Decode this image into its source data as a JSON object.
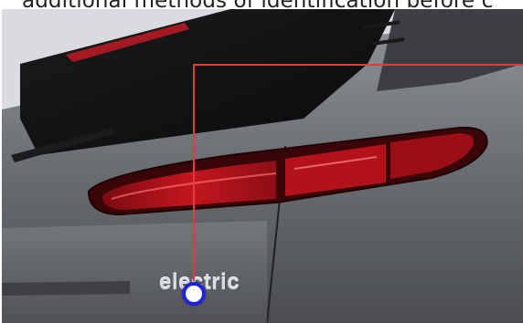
{
  "caption": {
    "text": "additional methods of identification before c"
  },
  "photo": {
    "badge_text": "electric",
    "vehicle": "rear-tail-light-view"
  },
  "callout": {
    "color": "#e23b3b",
    "hotspot_color": "#1e22e6"
  }
}
